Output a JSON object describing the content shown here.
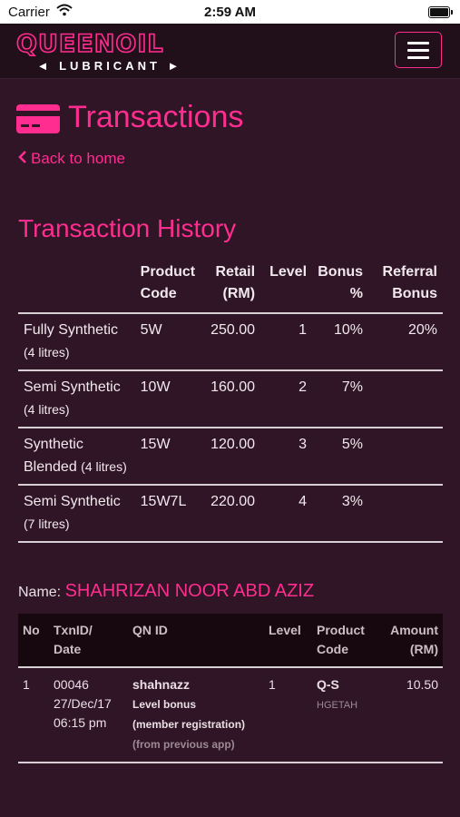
{
  "status_bar": {
    "carrier": "Carrier",
    "time": "2:59 AM"
  },
  "navbar": {
    "logo_title": "QUEENOIL",
    "logo_subtitle": "◄ LUBRICANT ►"
  },
  "page": {
    "title": "Transactions",
    "back_link": "Back to home"
  },
  "history": {
    "title": "Transaction History",
    "headers": {
      "product_line1": "",
      "code_line1": "Product",
      "code_line2": "Code",
      "retail_line1": "Retail",
      "retail_line2": "(RM)",
      "level": "Level",
      "bonus_line1": "Bonus",
      "bonus_line2": "%",
      "referral_line1": "Referral",
      "referral_line2": "Bonus"
    },
    "rows": [
      {
        "product": "Fully Synthetic",
        "volume": "(4 litres)",
        "code": "5W",
        "retail": "250.00",
        "level": "1",
        "bonus": "10%",
        "referral": "20%"
      },
      {
        "product": "Semi Synthetic",
        "volume": "(4 litres)",
        "code": "10W",
        "retail": "160.00",
        "level": "2",
        "bonus": "7%",
        "referral": ""
      },
      {
        "product": "Synthetic Blended",
        "volume": "(4 litres)",
        "code": "15W",
        "retail": "120.00",
        "level": "3",
        "bonus": "5%",
        "referral": ""
      },
      {
        "product": "Semi Synthetic",
        "volume": "(7 litres)",
        "code": "15W7L",
        "retail": "220.00",
        "level": "4",
        "bonus": "3%",
        "referral": ""
      }
    ]
  },
  "member": {
    "label": "Name:",
    "name": "SHAHRIZAN NOOR ABD AZIZ"
  },
  "transactions": {
    "headers": {
      "no": "No",
      "txn_line1": "TxnID/",
      "txn_line2": "Date",
      "qn": "QN ID",
      "level": "Level",
      "code_line1": "Product",
      "code_line2": "Code",
      "amount_line1": "Amount",
      "amount_line2": "(RM)"
    },
    "rows": [
      {
        "no": "1",
        "txn_id": "00046",
        "date": "27/Dec/17",
        "time": "06:15 pm",
        "qn_id": "shahnazz",
        "note1": "Level bonus",
        "note2": "(member registration)",
        "note3": "(from previous app)",
        "level": "1",
        "product_code": "Q-S",
        "product_sub": "HGETAH",
        "amount": "10.50"
      }
    ]
  },
  "colors": {
    "accent": "#ff2d8f",
    "background": "#2f1525",
    "navbar": "#21101a"
  }
}
